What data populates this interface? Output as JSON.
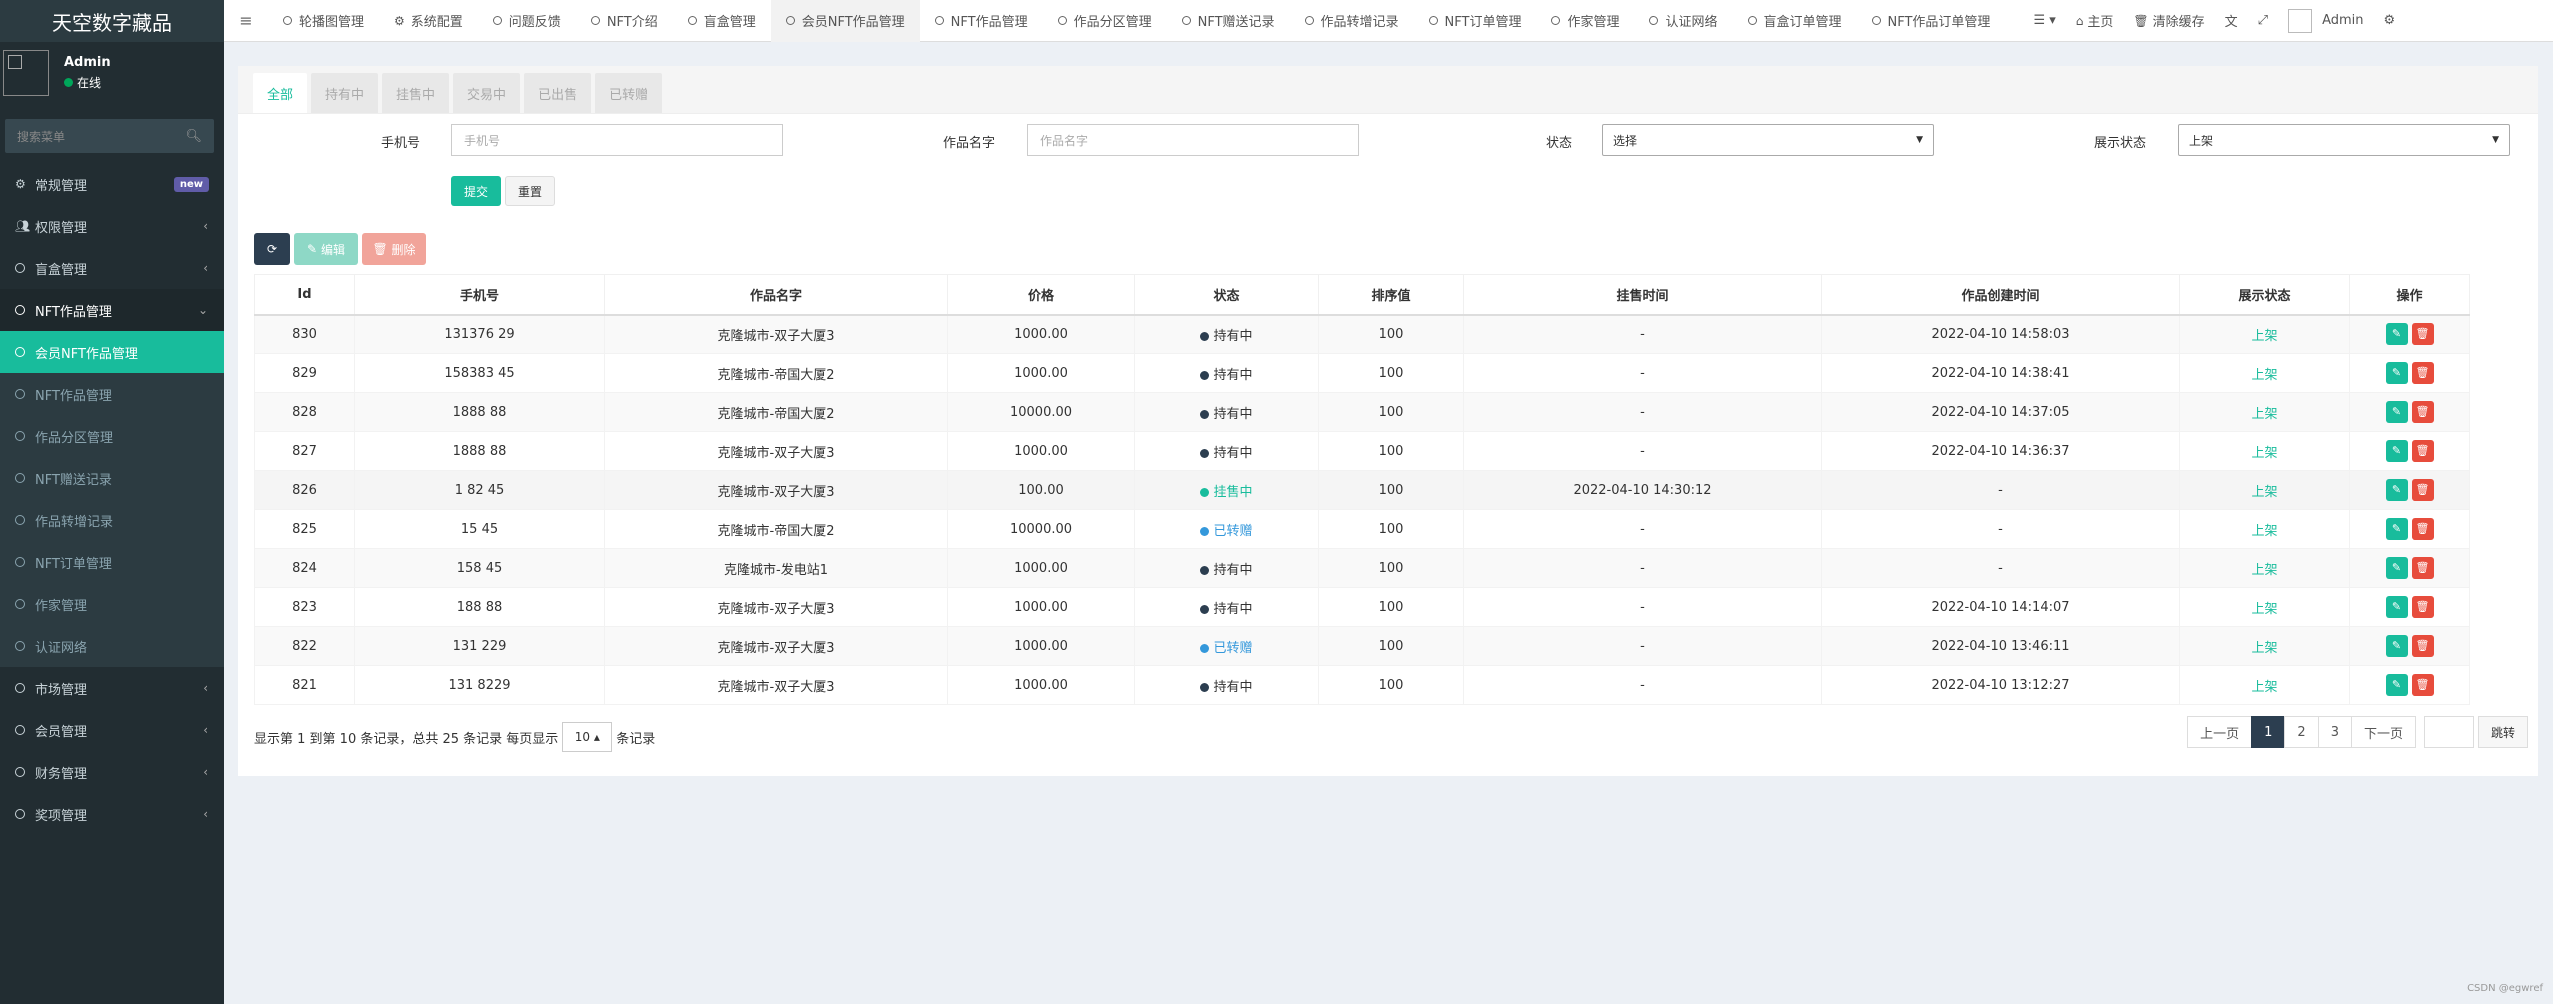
{
  "app": {
    "title": "天空数字藏品"
  },
  "user": {
    "name": "Admin",
    "status": "在线"
  },
  "sidebar": {
    "search_placeholder": "搜索菜单",
    "items": [
      {
        "label": "常规管理",
        "icon": "gears-icon",
        "badge": "new"
      },
      {
        "label": "权限管理",
        "icon": "users-icon"
      },
      {
        "label": "盲盒管理",
        "icon": "circle-icon"
      },
      {
        "label": "NFT作品管理",
        "icon": "circle-icon"
      },
      {
        "label": "会员NFT作品管理",
        "icon": "circle-icon"
      },
      {
        "label": "NFT作品管理",
        "icon": "circle-icon"
      },
      {
        "label": "作品分区管理",
        "icon": "circle-icon"
      },
      {
        "label": "NFT赠送记录",
        "icon": "circle-icon"
      },
      {
        "label": "作品转增记录",
        "icon": "circle-icon"
      },
      {
        "label": "NFT订单管理",
        "icon": "circle-icon"
      },
      {
        "label": "作家管理",
        "icon": "circle-icon"
      },
      {
        "label": "认证网络",
        "icon": "circle-icon"
      },
      {
        "label": "市场管理",
        "icon": "circle-icon"
      },
      {
        "label": "会员管理",
        "icon": "circle-icon"
      },
      {
        "label": "财务管理",
        "icon": "circle-icon"
      },
      {
        "label": "奖项管理",
        "icon": "circle-icon"
      }
    ]
  },
  "navbar": {
    "tabs": [
      "轮播图管理",
      "系统配置",
      "问题反馈",
      "NFT介绍",
      "盲盒管理",
      "会员NFT作品管理",
      "NFT作品管理",
      "作品分区管理",
      "NFT赠送记录",
      "作品转增记录",
      "NFT订单管理",
      "作家管理",
      "认证网络",
      "盲盒订单管理",
      "NFT作品订单管理"
    ],
    "home": "主页",
    "clear_cache": "清除缓存",
    "admin": "Admin"
  },
  "filter_tabs": [
    "全部",
    "持有中",
    "挂售中",
    "交易中",
    "已出售",
    "已转赠"
  ],
  "filter": {
    "phone_label": "手机号",
    "phone_placeholder": "手机号",
    "work_label": "作品名字",
    "work_placeholder": "作品名字",
    "status_label": "状态",
    "status_value": "选择",
    "display_label": "展示状态",
    "display_value": "上架",
    "submit": "提交",
    "reset": "重置"
  },
  "toolbar": {
    "edit": "编辑",
    "delete": "删除"
  },
  "table": {
    "headers": [
      "Id",
      "手机号",
      "作品名字",
      "价格",
      "状态",
      "排序值",
      "挂售时间",
      "作品创建时间",
      "展示状态",
      "操作"
    ],
    "rows": [
      {
        "id": "830",
        "phone": "131376  29",
        "name": "克隆城市-双子大厦3",
        "price": "1000.00",
        "status": "持有中",
        "status_color": "#2c3e50",
        "sort": "100",
        "sell_time": "-",
        "created": "2022-04-10 14:58:03",
        "display": "上架"
      },
      {
        "id": "829",
        "phone": "158383  45",
        "name": "克隆城市-帝国大厦2",
        "price": "1000.00",
        "status": "持有中",
        "status_color": "#2c3e50",
        "sort": "100",
        "sell_time": "-",
        "created": "2022-04-10 14:38:41",
        "display": "上架"
      },
      {
        "id": "828",
        "phone": "1888  88",
        "name": "克隆城市-帝国大厦2",
        "price": "10000.00",
        "status": "持有中",
        "status_color": "#2c3e50",
        "sort": "100",
        "sell_time": "-",
        "created": "2022-04-10 14:37:05",
        "display": "上架"
      },
      {
        "id": "827",
        "phone": "1888  88",
        "name": "克隆城市-双子大厦3",
        "price": "1000.00",
        "status": "持有中",
        "status_color": "#2c3e50",
        "sort": "100",
        "sell_time": "-",
        "created": "2022-04-10 14:36:37",
        "display": "上架"
      },
      {
        "id": "826",
        "phone": "1  82  45",
        "name": "克隆城市-双子大厦3",
        "price": "100.00",
        "status": "挂售中",
        "status_color": "#18bc9c",
        "sort": "100",
        "sell_time": "2022-04-10 14:30:12",
        "created": "-",
        "display": "上架"
      },
      {
        "id": "825",
        "phone": "15  45",
        "name": "克隆城市-帝国大厦2",
        "price": "10000.00",
        "status": "已转赠",
        "status_color": "#3498db",
        "sort": "100",
        "sell_time": "-",
        "created": "-",
        "display": "上架"
      },
      {
        "id": "824",
        "phone": "158  45",
        "name": "克隆城市-发电站1",
        "price": "1000.00",
        "status": "持有中",
        "status_color": "#2c3e50",
        "sort": "100",
        "sell_time": "-",
        "created": "-",
        "display": "上架"
      },
      {
        "id": "823",
        "phone": "188  88",
        "name": "克隆城市-双子大厦3",
        "price": "1000.00",
        "status": "持有中",
        "status_color": "#2c3e50",
        "sort": "100",
        "sell_time": "-",
        "created": "2022-04-10 14:14:07",
        "display": "上架"
      },
      {
        "id": "822",
        "phone": "131  229",
        "name": "克隆城市-双子大厦3",
        "price": "1000.00",
        "status": "已转赠",
        "status_color": "#3498db",
        "sort": "100",
        "sell_time": "-",
        "created": "2022-04-10 13:46:11",
        "display": "上架"
      },
      {
        "id": "821",
        "phone": "131  8229",
        "name": "克隆城市-双子大厦3",
        "price": "1000.00",
        "status": "持有中",
        "status_color": "#2c3e50",
        "sort": "100",
        "sell_time": "-",
        "created": "2022-04-10 13:12:27",
        "display": "上架"
      }
    ]
  },
  "footer": {
    "summary_prefix": "显示第 1 到第 10 条记录，总共 25 条记录 每页显示",
    "page_size": "10",
    "summary_suffix": "条记录"
  },
  "pager": {
    "prev": "上一页",
    "pages": [
      "1",
      "2",
      "3"
    ],
    "next": "下一页",
    "jump": "跳转"
  },
  "watermark": "CSDN @egwref",
  "colors": {
    "accent": "#18bc9c",
    "sidebar": "#222d32",
    "danger": "#e74c3c",
    "dark": "#2c3e50"
  }
}
